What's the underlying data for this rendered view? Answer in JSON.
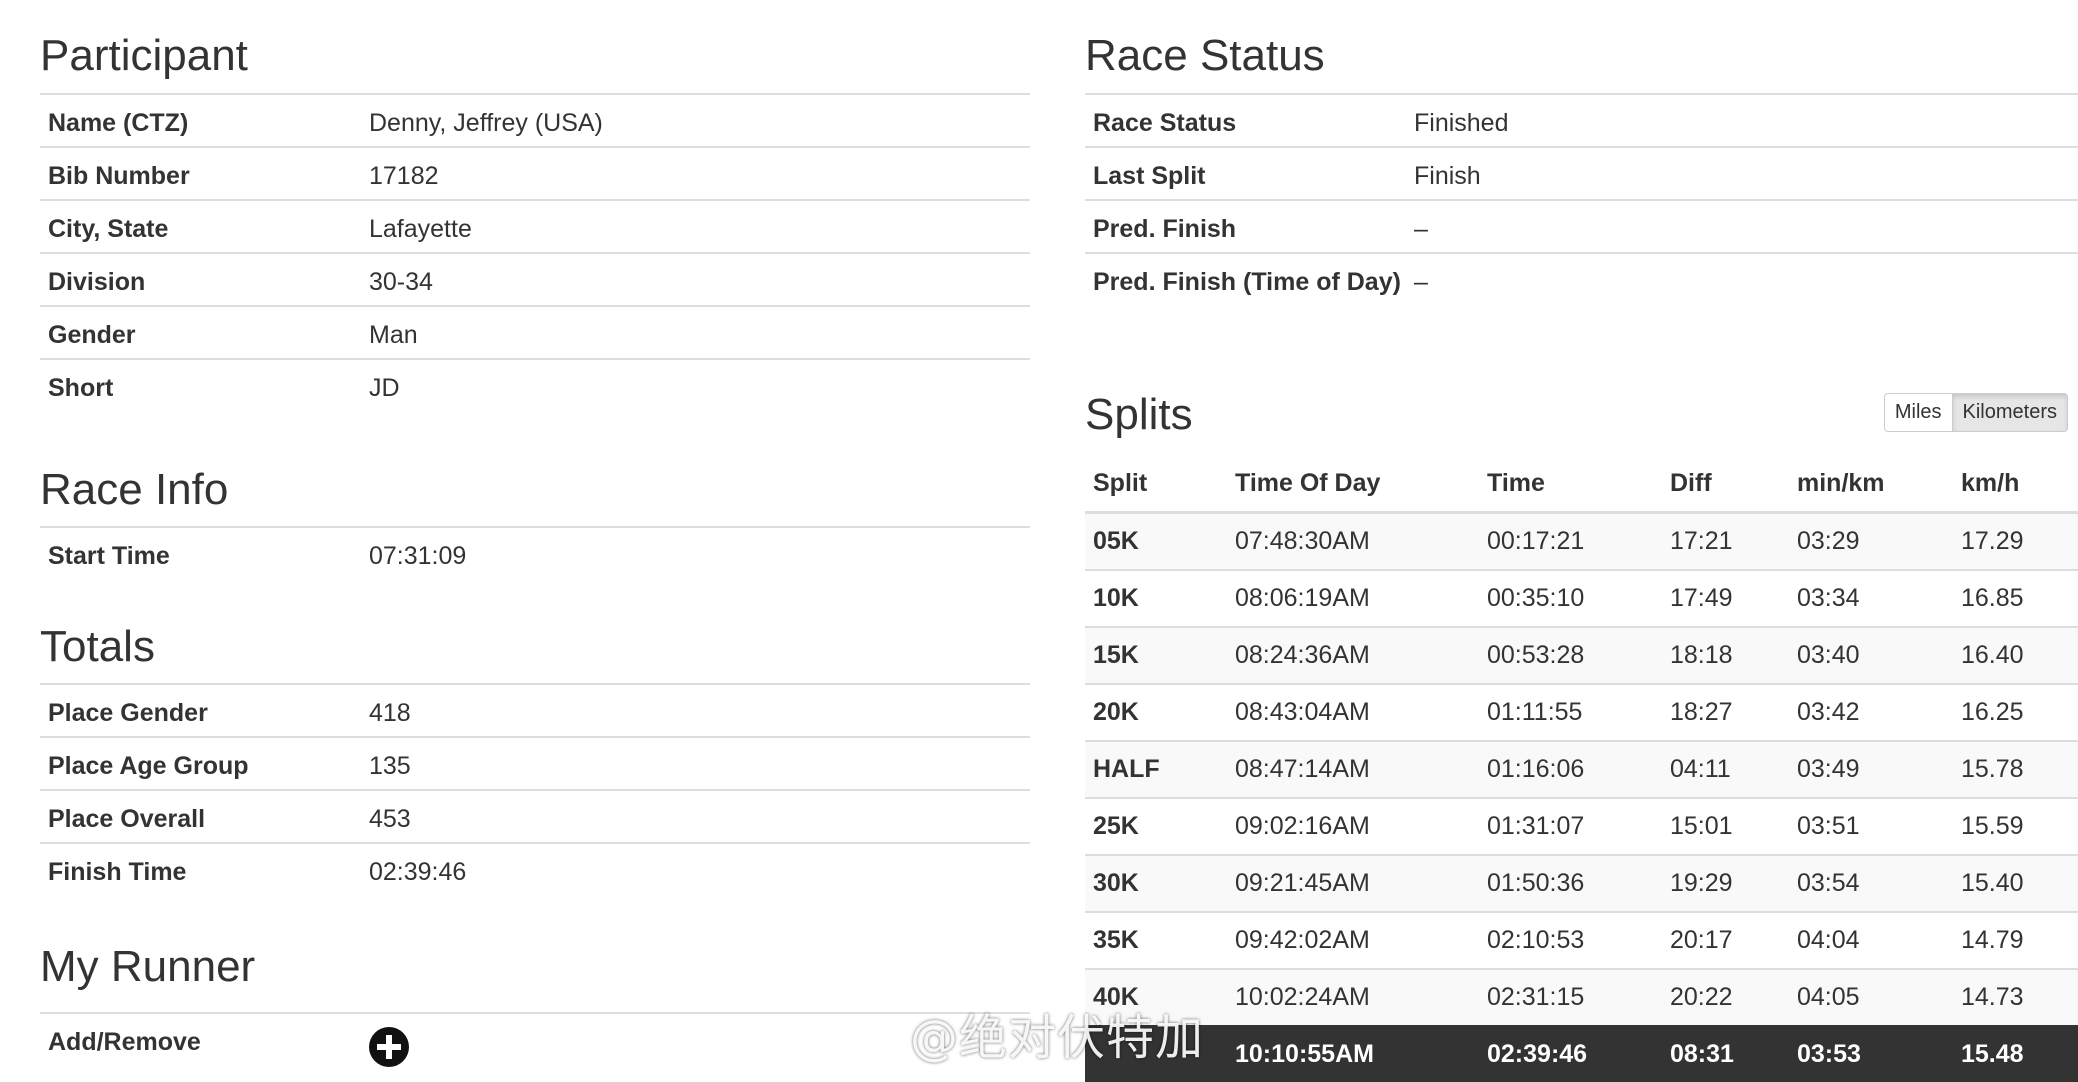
{
  "participant": {
    "title": "Participant",
    "rows": [
      {
        "label": "Name (CTZ)",
        "value": "Denny, Jeffrey (USA)"
      },
      {
        "label": "Bib Number",
        "value": "17182"
      },
      {
        "label": "City, State",
        "value": "Lafayette"
      },
      {
        "label": "Division",
        "value": "30-34"
      },
      {
        "label": "Gender",
        "value": "Man"
      },
      {
        "label": "Short",
        "value": "JD"
      }
    ]
  },
  "race_info": {
    "title": "Race Info",
    "rows": [
      {
        "label": "Start Time",
        "value": "07:31:09"
      }
    ]
  },
  "totals": {
    "title": "Totals",
    "rows": [
      {
        "label": "Place Gender",
        "value": "418"
      },
      {
        "label": "Place Age Group",
        "value": "135"
      },
      {
        "label": "Place Overall",
        "value": "453"
      },
      {
        "label": "Finish Time",
        "value": "02:39:46"
      }
    ]
  },
  "my_runner": {
    "title": "My Runner",
    "label": "Add/Remove",
    "icon": "plus-circle-icon"
  },
  "race_status": {
    "title": "Race Status",
    "rows": [
      {
        "label": "Race Status",
        "value": "Finished"
      },
      {
        "label": "Last Split",
        "value": "Finish"
      },
      {
        "label": "Pred. Finish",
        "value": "–"
      },
      {
        "label": "Pred. Finish (Time of Day)",
        "value": "–"
      }
    ]
  },
  "splits": {
    "title": "Splits",
    "unit_toggle": {
      "options": [
        "Miles",
        "Kilometers"
      ],
      "active": "Kilometers"
    },
    "columns": [
      "Split",
      "Time Of Day",
      "Time",
      "Diff",
      "min/km",
      "km/h"
    ],
    "rows": [
      [
        "05K",
        "07:48:30AM",
        "00:17:21",
        "17:21",
        "03:29",
        "17.29"
      ],
      [
        "10K",
        "08:06:19AM",
        "00:35:10",
        "17:49",
        "03:34",
        "16.85"
      ],
      [
        "15K",
        "08:24:36AM",
        "00:53:28",
        "18:18",
        "03:40",
        "16.40"
      ],
      [
        "20K",
        "08:43:04AM",
        "01:11:55",
        "18:27",
        "03:42",
        "16.25"
      ],
      [
        "HALF",
        "08:47:14AM",
        "01:16:06",
        "04:11",
        "03:49",
        "15.78"
      ],
      [
        "25K",
        "09:02:16AM",
        "01:31:07",
        "15:01",
        "03:51",
        "15.59"
      ],
      [
        "30K",
        "09:21:45AM",
        "01:50:36",
        "19:29",
        "03:54",
        "15.40"
      ],
      [
        "35K",
        "09:42:02AM",
        "02:10:53",
        "20:17",
        "04:04",
        "14.79"
      ],
      [
        "40K",
        "10:02:24AM",
        "02:31:15",
        "20:22",
        "04:05",
        "14.73"
      ],
      [
        "",
        "10:10:55AM",
        "02:39:46",
        "08:31",
        "03:53",
        "15.48"
      ]
    ]
  },
  "watermark": {
    "text": "@绝对伏特加",
    "icon": "weibo-icon"
  },
  "colors": {
    "finish_row_bg": "#333333",
    "border": "#dddddd",
    "stripe": "#f9f9f9"
  }
}
